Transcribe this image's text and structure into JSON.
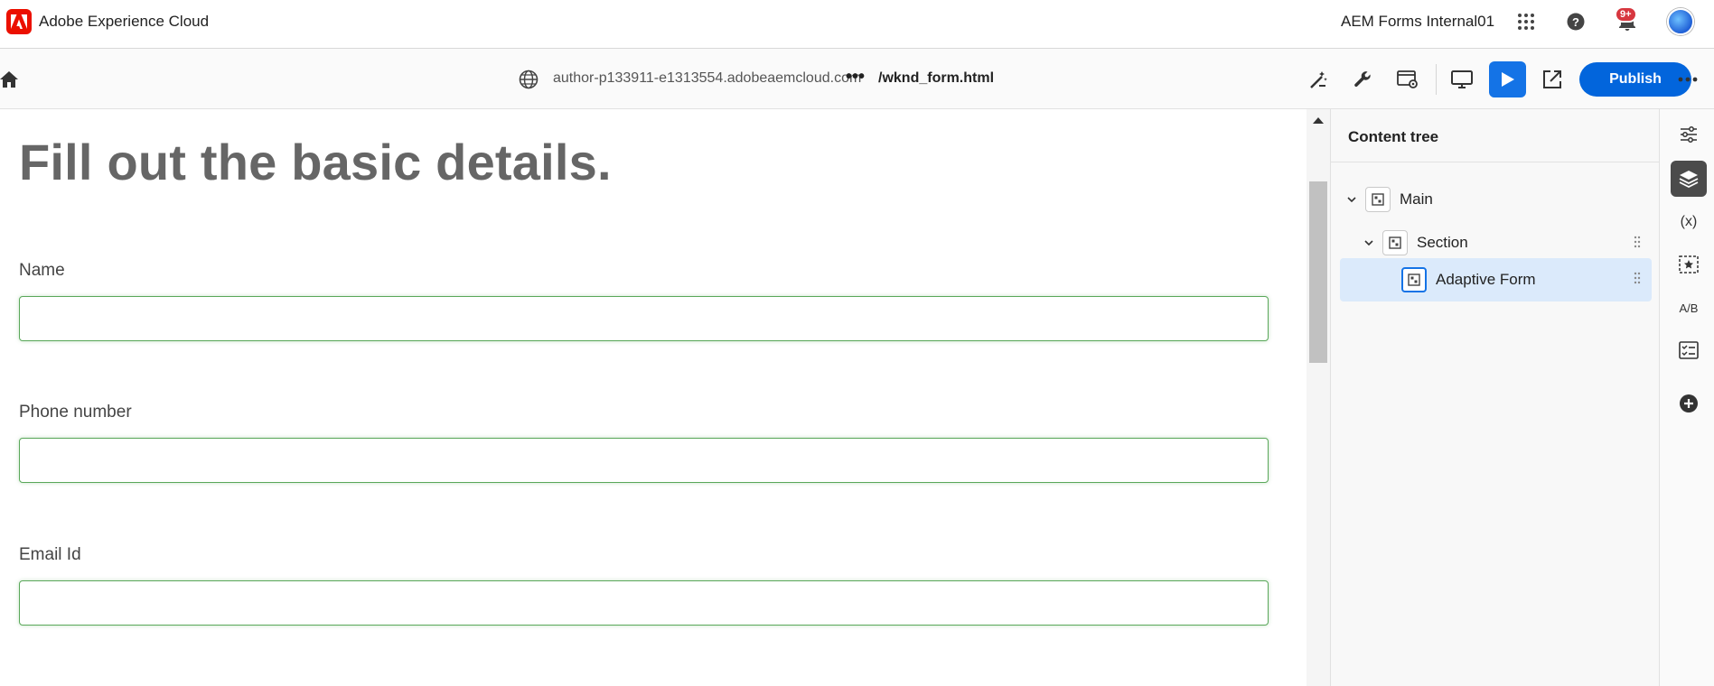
{
  "shell": {
    "brand": "Adobe Experience Cloud",
    "org": "AEM Forms Internal01",
    "notification_badge": "9+"
  },
  "toolbar": {
    "url": "author-p133911-e1313554.adobeaemcloud.com",
    "more_path": "•••",
    "path": "/wknd_form.html",
    "publish_label": "Publish"
  },
  "form": {
    "heading": "Fill out the basic details.",
    "fields": [
      {
        "label": "Name",
        "value": ""
      },
      {
        "label": "Phone number",
        "value": ""
      },
      {
        "label": "Email Id",
        "value": ""
      }
    ]
  },
  "panel": {
    "title": "Content tree",
    "tree": [
      {
        "label": "Main"
      },
      {
        "label": "Section"
      },
      {
        "label": "Adaptive Form"
      }
    ]
  },
  "rail": {
    "variables_label": "(x)",
    "ab_label": "A/B"
  },
  "colors": {
    "adobe_red": "#eb1000",
    "accent_blue": "#0265dc",
    "field_border": "#5aa85a",
    "selected_row": "#dbeafb"
  }
}
